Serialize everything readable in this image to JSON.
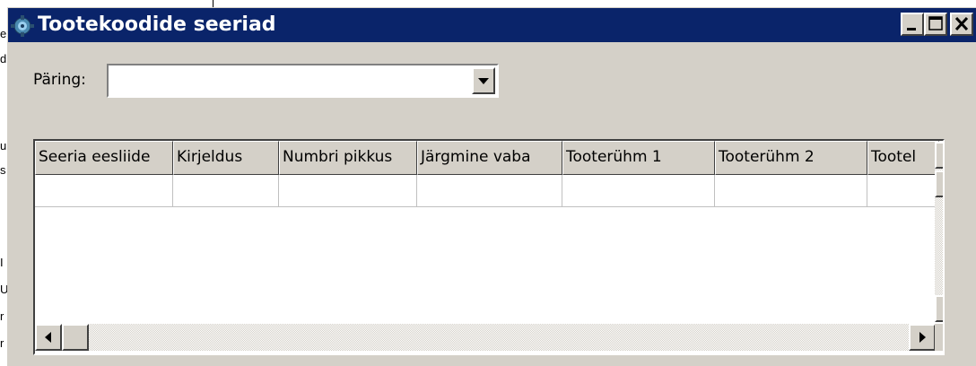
{
  "window": {
    "title": "Tootekoodide seeriad",
    "controls": [
      "minimize",
      "maximize",
      "close"
    ]
  },
  "query": {
    "label": "Päring:",
    "value": ""
  },
  "grid": {
    "columns": [
      "Seeria eesliide",
      "Kirjeldus",
      "Numbri pikkus",
      "Järgmine vaba",
      "Tooterühm 1",
      "Tooterühm 2",
      "Tootel"
    ],
    "rows": [
      [
        "",
        "",
        "",
        "",
        "",
        "",
        ""
      ]
    ]
  },
  "background_fragments": [
    "e",
    "d",
    "u",
    "s",
    "I",
    "U",
    "r",
    "r"
  ],
  "colors": {
    "titlebar": "#0a246a",
    "face": "#d4d0c8",
    "title_text": "#ffffff"
  },
  "icons": [
    "app-icon",
    "minimize-icon",
    "maximize-icon",
    "close-icon",
    "dropdown-arrow-icon",
    "scroll-up-icon",
    "scroll-down-icon",
    "scroll-left-icon",
    "scroll-right-icon"
  ]
}
